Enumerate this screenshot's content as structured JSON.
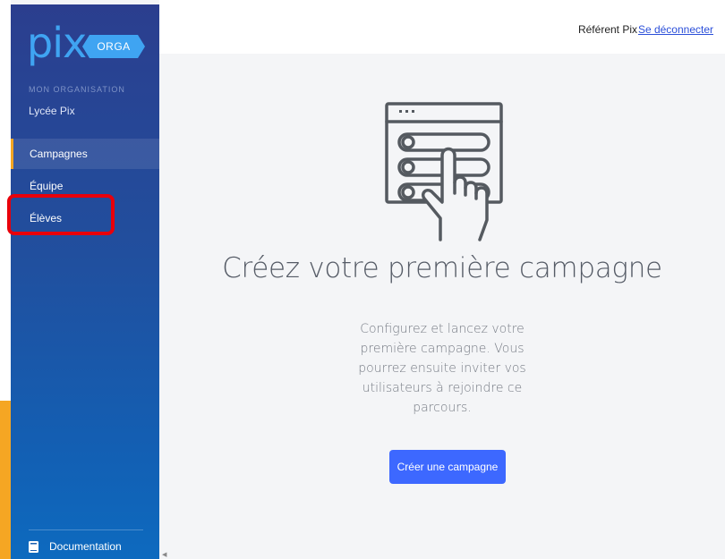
{
  "brand": {
    "logo_text": "pix",
    "badge_text": "ORGA"
  },
  "organization": {
    "label": "MON ORGANISATION",
    "name": "Lycée Pix"
  },
  "nav": {
    "items": [
      {
        "label": "Campagnes",
        "active": true
      },
      {
        "label": "Équipe",
        "active": false
      },
      {
        "label": "Élèves",
        "active": false
      }
    ]
  },
  "footer": {
    "documentation_label": "Documentation"
  },
  "topbar": {
    "user_name": "Référent Pix",
    "logout_label": "Se déconnecter"
  },
  "empty_state": {
    "title": "Créez votre première campagne",
    "description": "Configurez et lancez votre première campagne. Vous pourrez ensuite inviter vos utilisateurs à rejoindre ce parcours.",
    "button_label": "Créer une campagne",
    "illustration_icon": "campaign-hand-icon"
  },
  "colors": {
    "sidebar_top": "#2b3e8e",
    "sidebar_bottom": "#0d6abf",
    "active_accent": "#f5a623",
    "highlight": "#e8000b",
    "primary_button": "#3d68ff",
    "link": "#2b4fd9"
  }
}
